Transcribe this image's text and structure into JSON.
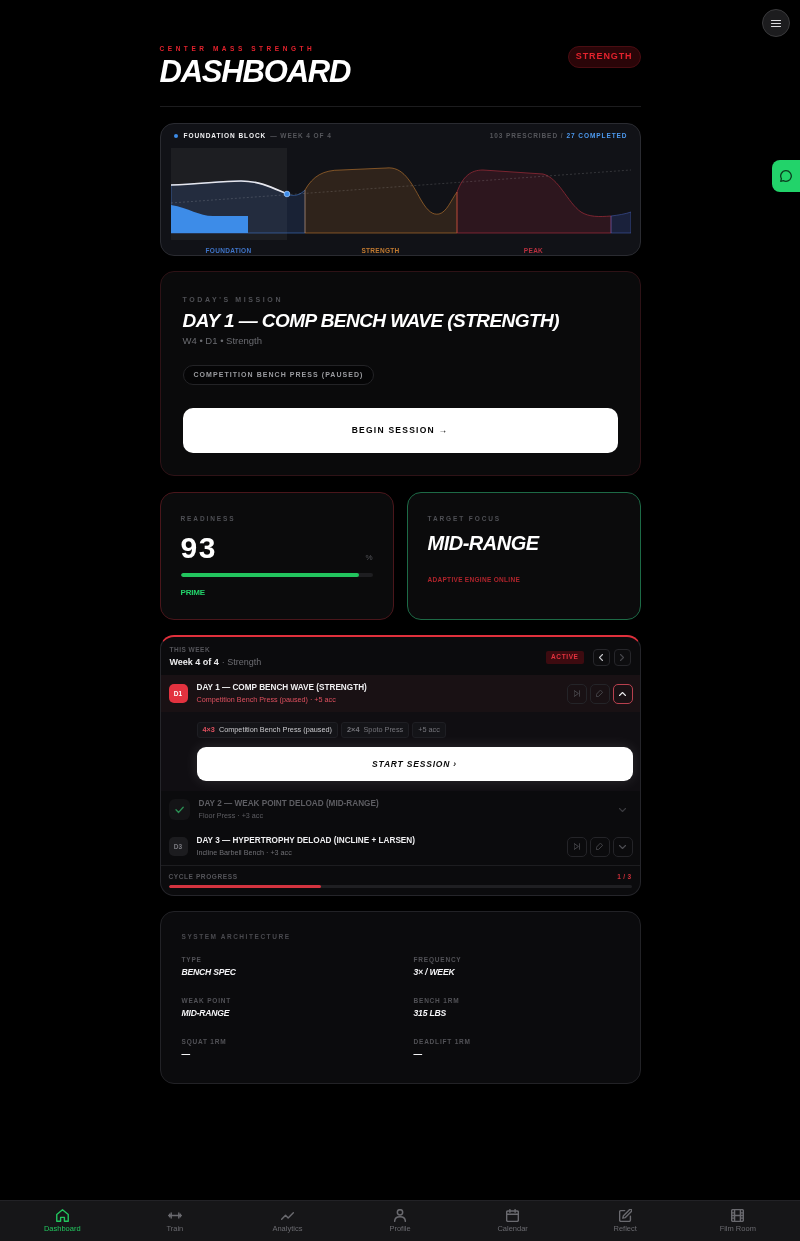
{
  "header": {
    "brand": "CENTER MASS STRENGTH",
    "title": "DASHBOARD",
    "badge": "STRENGTH"
  },
  "block": {
    "name": "FOUNDATION BLOCK",
    "week": "— WEEK 4 OF 4",
    "prescribed": "103 PRESCRIBED /",
    "completed": "27 COMPLETED",
    "phases": [
      {
        "label": "FOUNDATION",
        "color": "#3f74c8"
      },
      {
        "label": "STRENGTH",
        "color": "#c27a30"
      },
      {
        "label": "PEAK",
        "color": "#b8303f"
      }
    ]
  },
  "mission": {
    "label": "TODAY'S MISSION",
    "title": "DAY 1 — COMP BENCH WAVE (STRENGTH)",
    "meta": "W4 • D1 • Strength",
    "exercise": "COMPETITION BENCH PRESS (PAUSED)",
    "button": "BEGIN SESSION →"
  },
  "readiness": {
    "label": "READINESS",
    "value": "93",
    "unit": "%",
    "level": 0.93,
    "status": "PRIME"
  },
  "focus": {
    "label": "TARGET FOCUS",
    "value": "MID-RANGE",
    "note": "ADAPTIVE ENGINE ONLINE"
  },
  "week": {
    "label": "THIS WEEK",
    "title": "Week 4 of 4",
    "phase": "· Strength",
    "badge": "ACTIVE",
    "pager": [
      {
        "kind": "prev",
        "disabled": false
      },
      {
        "kind": "next",
        "disabled": true
      }
    ],
    "days": [
      {
        "badge": "D1",
        "title": "DAY 1 — COMP BENCH WAVE (STRENGTH)",
        "subtitle": "Competition Bench Press (paused) · +5 acc",
        "current": true,
        "done": false,
        "expanded": true,
        "exercises": [
          {
            "sets": "4×3",
            "name": "Competition Bench Press (paused)",
            "primary": true
          },
          {
            "sets": "2×4",
            "name": "Spoto Press",
            "primary": false
          },
          {
            "name": "+5 acc",
            "primary": false
          }
        ],
        "button": "START SESSION ›"
      },
      {
        "title": "DAY 2 — WEAK POINT DELOAD (MID-RANGE)",
        "subtitle": "Floor Press · +3 acc",
        "current": false,
        "done": true,
        "expanded": false
      },
      {
        "badge": "D3",
        "title": "DAY 3 — HYPERTROPHY DELOAD (INCLINE + LARSEN)",
        "subtitle": "Incline Barbell Bench · +3 acc",
        "current": false,
        "done": false,
        "expanded": false
      }
    ],
    "progress": {
      "label": "CYCLE PROGRESS",
      "reading": "1 / 3",
      "level": 0.33
    }
  },
  "system": {
    "title": "SYSTEM ARCHITECTURE",
    "items": [
      {
        "label": "TYPE",
        "value": "BENCH SPEC"
      },
      {
        "label": "FREQUENCY",
        "value": "3× / WEEK"
      },
      {
        "label": "WEAK POINT",
        "value": "MID-RANGE"
      },
      {
        "label": "BENCH 1RM",
        "value": "315 LBS"
      },
      {
        "label": "SQUAT 1RM",
        "value": "—"
      },
      {
        "label": "DEADLIFT 1RM",
        "value": "—"
      }
    ]
  },
  "nav": [
    {
      "label": "Dashboard",
      "selected": true
    },
    {
      "label": "Train",
      "selected": false
    },
    {
      "label": "Analytics",
      "selected": false
    },
    {
      "label": "Profile",
      "selected": false
    },
    {
      "label": "Calendar",
      "selected": false
    },
    {
      "label": "Reflect",
      "selected": false
    },
    {
      "label": "Film Room",
      "selected": false
    }
  ]
}
